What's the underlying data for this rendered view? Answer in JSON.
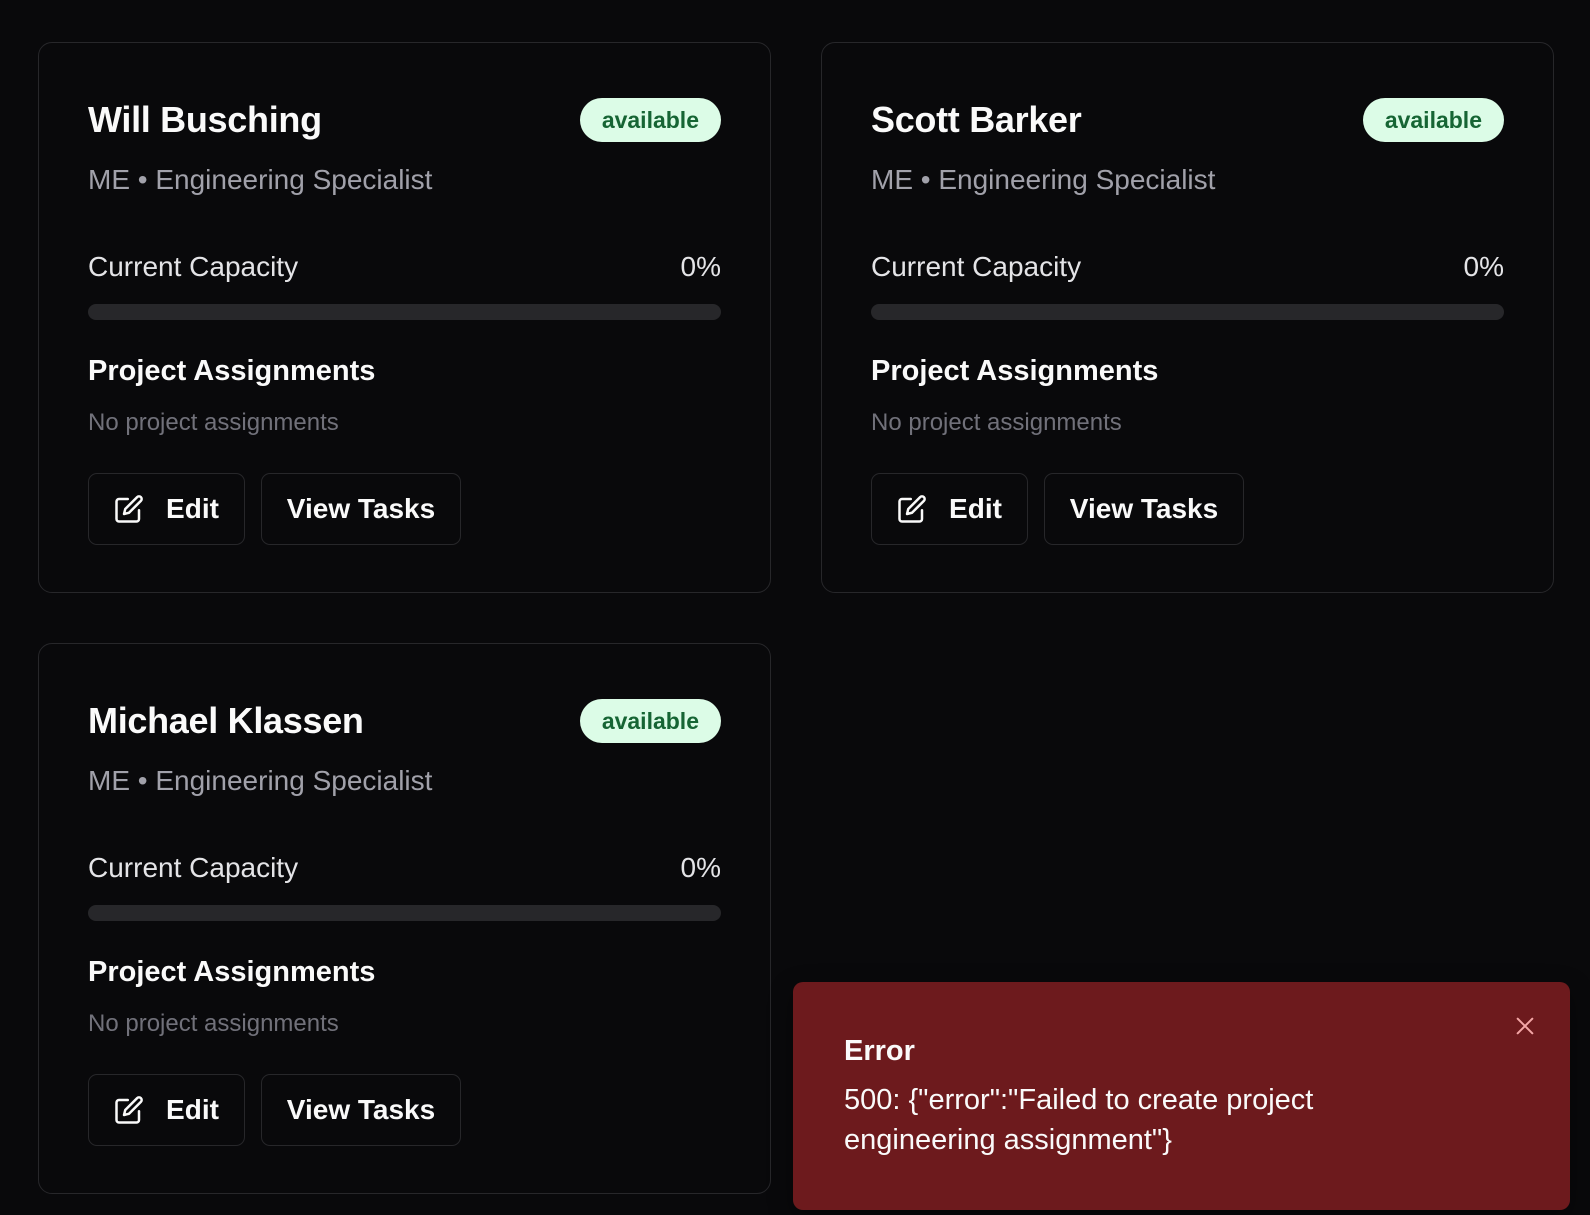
{
  "cards": [
    {
      "name": "Will Busching",
      "status": "available",
      "role": "ME • Engineering Specialist",
      "capacity_label": "Current Capacity",
      "capacity_value": "0%",
      "capacity_fraction": 0,
      "assignments_title": "Project Assignments",
      "assignments_empty": "No project assignments",
      "edit_label": "Edit",
      "view_label": "View Tasks"
    },
    {
      "name": "Scott Barker",
      "status": "available",
      "role": "ME • Engineering Specialist",
      "capacity_label": "Current Capacity",
      "capacity_value": "0%",
      "capacity_fraction": 0,
      "assignments_title": "Project Assignments",
      "assignments_empty": "No project assignments",
      "edit_label": "Edit",
      "view_label": "View Tasks"
    },
    {
      "name": "Michael Klassen",
      "status": "available",
      "role": "ME • Engineering Specialist",
      "capacity_label": "Current Capacity",
      "capacity_value": "0%",
      "capacity_fraction": 0,
      "assignments_title": "Project Assignments",
      "assignments_empty": "No project assignments",
      "edit_label": "Edit",
      "view_label": "View Tasks"
    }
  ],
  "toast": {
    "title": "Error",
    "message": "500: {\"error\":\"Failed to create project engineering assignment\"}",
    "close_icon": "close-icon"
  },
  "colors": {
    "background": "#09090b",
    "card_border": "#27272a",
    "badge_bg": "#dcfce7",
    "badge_text": "#166534",
    "toast_bg": "#6d1a1d"
  },
  "icons": {
    "edit": "edit-icon"
  }
}
